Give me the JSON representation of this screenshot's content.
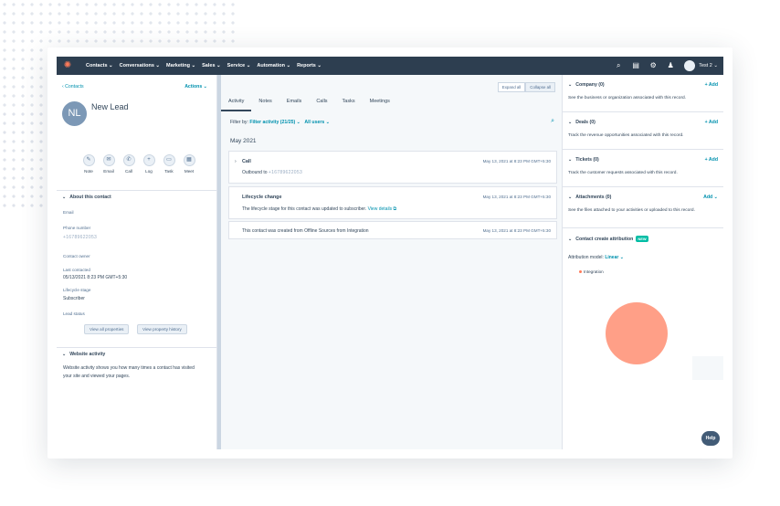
{
  "nav": {
    "items": [
      "Contacts ⌄",
      "Conversations ⌄",
      "Marketing ⌄",
      "Sales ⌄",
      "Service ⌄",
      "Automation ⌄",
      "Reports ⌄"
    ],
    "account": "Test 2 ⌄"
  },
  "contact": {
    "back_label": "‹ Contacts",
    "actions_label": "Actions ⌄",
    "initials": "NL",
    "name": "New Lead",
    "quick_actions": [
      "Note",
      "Email",
      "Call",
      "Log",
      "Task",
      "Meet"
    ],
    "about_title": "About this contact",
    "fields": {
      "email_label": "Email",
      "phone_label": "Phone number",
      "phone_value": "+16789622053",
      "owner_label": "Contact owner",
      "last_contacted_label": "Last contacted",
      "last_contacted_value": "05/13/2021 8:23 PM GMT+5:30",
      "lifecycle_label": "Lifecycle stage",
      "lifecycle_value": "Subscriber",
      "lead_status_label": "Lead status"
    },
    "view_all_label": "View all properties",
    "view_history_label": "View property history",
    "website_title": "Website activity",
    "website_desc_1": "Website activity shows you how many times a contact has visited",
    "website_desc_2": "your site and viewed your pages."
  },
  "activity": {
    "tabs": [
      "Activity",
      "Notes",
      "Emails",
      "Calls",
      "Tasks",
      "Meetings"
    ],
    "expand_all": "Expand all",
    "collapse_all": "Collapse all",
    "filter_by": "Filter by:",
    "filter_activity": "Filter activity (21/25) ⌄",
    "all_users": "All users ⌄",
    "month": "May 2021",
    "cards": [
      {
        "title": "Call",
        "body_prefix": "Outbound to ",
        "body_link": "+16789622053",
        "date": "May 13, 2021 at 8:23 PM GMT+5:30"
      },
      {
        "title": "Lifecycle change",
        "body_prefix": "The lifecycle stage for this contact was updated to subscriber. ",
        "body_link": "View details",
        "date": "May 13, 2021 at 8:23 PM GMT+5:30"
      },
      {
        "title": "",
        "body_prefix": "This contact was created from Offline Sources from Integration",
        "body_link": "",
        "date": "May 13, 2021 at 8:23 PM GMT+5:30"
      }
    ]
  },
  "sidebar": {
    "sections": [
      {
        "title": "Company (0)",
        "add": "+ Add",
        "desc": "See the business or organization associated with this record."
      },
      {
        "title": "Deals (0)",
        "add": "+ Add",
        "desc": "Track the revenue opportunities associated with this record."
      },
      {
        "title": "Tickets (0)",
        "add": "+ Add",
        "desc": "Track the customer requests associated with this record."
      },
      {
        "title": "Attachments (0)",
        "add": "Add ⌄",
        "desc": "See the files attached to your activities or uploaded to this record."
      }
    ],
    "attribution_title": "Contact create attribution",
    "new_badge": "NEW",
    "model_label": "Attribution model:",
    "model_value": "Linear ⌄",
    "legend": "Integration",
    "help": "Help"
  },
  "chart_data": {
    "type": "pie",
    "categories": [
      "Integration"
    ],
    "values": [
      100
    ]
  }
}
